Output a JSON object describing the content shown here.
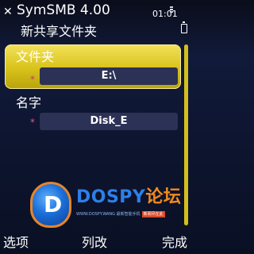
{
  "status": {
    "app_title": "SymSMB 4.00",
    "dialog_title": "新共享文件夹",
    "clock": "01:01"
  },
  "form": {
    "fields": [
      {
        "label": "文件夹",
        "required_mark": "*",
        "value": "E:\\"
      },
      {
        "label": "名字",
        "required_mark": "*",
        "value": "Disk_E"
      }
    ],
    "colors": {
      "selected_bg": "#e0cb2a",
      "value_box_bg": "#2c3156",
      "required_on_selected": "#c43a6a",
      "required_normal": "#d85a8a"
    }
  },
  "watermark": {
    "logo_letter": "D",
    "brand": "DOSPY",
    "brand_cn": "论坛",
    "url": "WWW.DOSPY.WANG",
    "sub_a": "最新智能手机",
    "sub_b": "新闻尽在此"
  },
  "softkeys": {
    "left": "选项",
    "middle": "列改",
    "right": "完成"
  }
}
